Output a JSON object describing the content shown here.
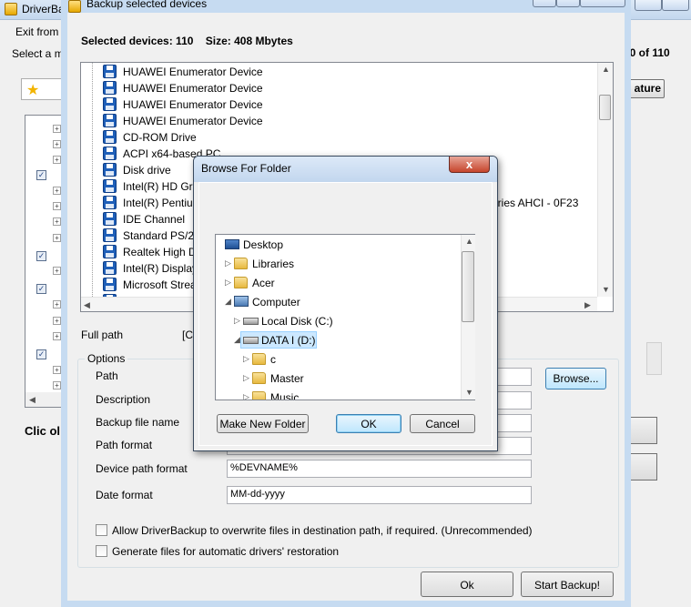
{
  "main_window": {
    "title": "DriverBa",
    "menu_exit": "Exit from",
    "select_prompt": "Select a m",
    "device_count": "10 of 110",
    "feature_button": "ature",
    "click_hint": "Clic ol"
  },
  "backup_dialog": {
    "title": "Backup selected devices",
    "selected_label": "Selected devices: 110",
    "size_label": "Size: 408 Mbytes",
    "devices": [
      "HUAWEI Enumerator Device",
      "HUAWEI Enumerator Device",
      "HUAWEI Enumerator Device",
      "HUAWEI Enumerator Device",
      "CD-ROM Drive",
      "ACPI x64-based PC",
      "Disk drive",
      "Intel(R) HD Grap",
      "Intel(R) Pentium(",
      "IDE Channel",
      "Standard PS/2 K",
      "Realtek High De",
      "Intel(R) Display A",
      "Microsoft Stream"
    ],
    "partial_device_suffix": "eries AHCI - 0F23",
    "full_path_label": "Full path",
    "full_path_value": "[Cl",
    "options_title": "Options",
    "fields": {
      "path_label": "Path",
      "description_label": "Description",
      "backup_file_name_label": "Backup file name",
      "path_format_label": "Path format",
      "device_path_format_label": "Device path format",
      "device_path_format_value": "%DEVNAME%",
      "date_format_label": "Date format",
      "date_format_value": "MM-dd-yyyy"
    },
    "browse_button": "Browse...",
    "allow_overwrite_label": "Allow DriverBackup to overwrite files in destination path, if required. (Unrecommended)",
    "generate_files_label": "Generate files for automatic drivers' restoration",
    "ok_button": "Ok",
    "start_button": "Start Backup!"
  },
  "browse_dialog": {
    "title": "Browse For Folder",
    "close_glyph": "x",
    "tree": [
      {
        "label": "Desktop",
        "icon": "desktop-icon"
      },
      {
        "label": "Libraries",
        "icon": "libraries-icon"
      },
      {
        "label": "Acer",
        "icon": "user-folder-icon"
      },
      {
        "label": "Computer",
        "icon": "computer-icon"
      },
      {
        "label": "Local Disk (C:)",
        "icon": "hard-drive-icon"
      },
      {
        "label": "DATA I (D:)",
        "icon": "hard-drive-icon",
        "selected": true
      },
      {
        "label": "c",
        "icon": "folder-icon"
      },
      {
        "label": "Master",
        "icon": "folder-icon"
      },
      {
        "label": "Music",
        "icon": "folder-icon"
      }
    ],
    "make_new_folder_button": "Make New Folder",
    "ok_button": "OK",
    "cancel_button": "Cancel"
  },
  "colors": {
    "selection": "#cce8ff",
    "close_button": "#c6452c",
    "titlebar": "#c6dbf1"
  }
}
